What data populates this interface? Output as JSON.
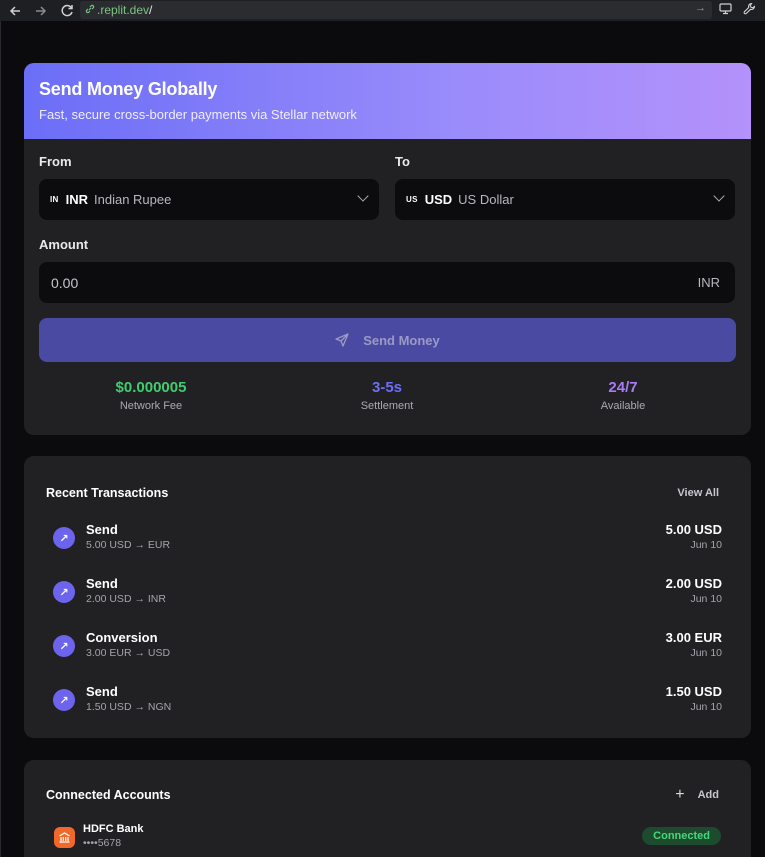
{
  "browser": {
    "url_host": ".replit.dev",
    "url_path": "/"
  },
  "send": {
    "title": "Send Money Globally",
    "subtitle": "Fast, secure cross-border payments via Stellar network",
    "from_label": "From",
    "to_label": "To",
    "from": {
      "flag": "IN",
      "code": "INR",
      "name": "Indian Rupee"
    },
    "to": {
      "flag": "US",
      "code": "USD",
      "name": "US Dollar"
    },
    "amount_label": "Amount",
    "amount_placeholder": "0.00",
    "amount_unit": "INR",
    "send_button": "Send Money",
    "stats": [
      {
        "value": "$0.000005",
        "label": "Network Fee",
        "color": "#3fce6e"
      },
      {
        "value": "3-5s",
        "label": "Settlement",
        "color": "#6b6ef7"
      },
      {
        "value": "24/7",
        "label": "Available",
        "color": "#a87bf7"
      }
    ]
  },
  "transactions": {
    "title": "Recent Transactions",
    "view_all": "View All",
    "items": [
      {
        "type": "Send",
        "desc": "5.00 USD → EUR",
        "amount": "5.00 USD",
        "date": "Jun 10"
      },
      {
        "type": "Send",
        "desc": "2.00 USD → INR",
        "amount": "2.00 USD",
        "date": "Jun 10"
      },
      {
        "type": "Conversion",
        "desc": "3.00 EUR → USD",
        "amount": "3.00 EUR",
        "date": "Jun 10"
      },
      {
        "type": "Send",
        "desc": "1.50 USD → NGN",
        "amount": "1.50 USD",
        "date": "Jun 10"
      }
    ]
  },
  "accounts": {
    "title": "Connected Accounts",
    "add_label": "Add",
    "items": [
      {
        "name": "HDFC Bank",
        "number": "••••5678",
        "status": "Connected"
      }
    ]
  },
  "icons": {
    "back": "arrow-left-icon",
    "forward": "arrow-right-icon",
    "reload": "reload-icon",
    "send": "paper-plane-icon",
    "tx": "arrow-up-right-icon",
    "bank": "bank-icon"
  }
}
